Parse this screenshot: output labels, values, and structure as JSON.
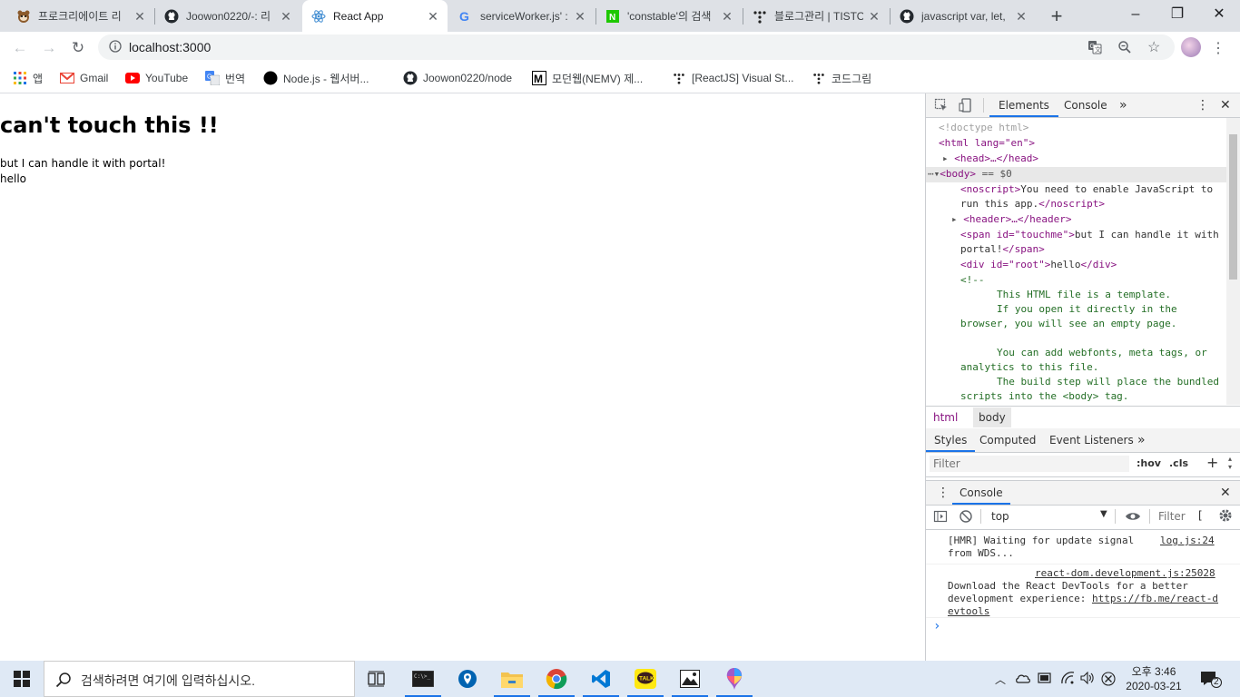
{
  "tabs": [
    {
      "title": "프로크리에이트 리",
      "icon": "tanuki-icon",
      "active": false
    },
    {
      "title": "Joowon0220/-: 리",
      "icon": "github-icon",
      "active": false
    },
    {
      "title": "React App",
      "icon": "react-icon",
      "active": true
    },
    {
      "title": "serviceWorker.js' :",
      "icon": "google-icon",
      "active": false
    },
    {
      "title": "'constable'의 검색",
      "icon": "naver-icon",
      "active": false
    },
    {
      "title": "블로그관리 | TISTO",
      "icon": "tistory-icon",
      "active": false
    },
    {
      "title": "javascript var, let,",
      "icon": "github-icon",
      "active": false
    }
  ],
  "new_tab_label": "+",
  "window_controls": {
    "minimize": "–",
    "restore": "❐",
    "close": "✕"
  },
  "address_bar": {
    "url": "localhost:3000"
  },
  "bookmarks": [
    {
      "label": "앱",
      "icon": "apps-grid-icon"
    },
    {
      "label": "Gmail",
      "icon": "gmail-icon"
    },
    {
      "label": "YouTube",
      "icon": "youtube-icon"
    },
    {
      "label": "번역",
      "icon": "translate-icon"
    },
    {
      "label": "Node.js - 웹서버...",
      "icon": "circle-icon"
    },
    {
      "label": "Joowon0220/node",
      "icon": "github-icon"
    },
    {
      "label": "모던웹(NEMV) 제...",
      "icon": "m-icon"
    },
    {
      "label": "[ReactJS] Visual St...",
      "icon": "tistory-icon"
    },
    {
      "label": "코드그림",
      "icon": "tistory-icon"
    }
  ],
  "page": {
    "heading": "can't touch this !!",
    "portal_text": "but I can handle it with portal!",
    "root_text": "hello"
  },
  "devtools": {
    "tabs": [
      "Elements",
      "Console"
    ],
    "elements_lines": {
      "doctype": "<!doctype html>",
      "html_open": "<html lang=\"en\">",
      "head": "<head>…</head>",
      "body": "<body>",
      "body_suffix": " == $0",
      "noscript_open": "<noscript>",
      "noscript_text": "You need to enable JavaScript to",
      "noscript_text2": "run this app.",
      "noscript_close": "</noscript>",
      "header": "<header>…</header>",
      "span_open": "<span id=\"touchme\">",
      "span_text": "but I can handle it with",
      "span_text2": "portal!",
      "span_close": "</span>",
      "div_open": "<div id=\"root\">",
      "div_text": "hello",
      "div_close": "</div>",
      "comment_open": "<!--",
      "c1": "This HTML file is a template.",
      "c2": "If you open it directly in the",
      "c3": "browser, you will see an empty page.",
      "c4": "You can add webfonts, meta tags, or",
      "c5": "analytics to this file.",
      "c6": "The build step will place the bundled",
      "c7": "scripts into the <body> tag."
    },
    "breadcrumbs": [
      "html",
      "body"
    ],
    "styles_tabs": [
      "Styles",
      "Computed",
      "Event Listeners"
    ],
    "styles_filter_placeholder": "Filter",
    "styles_hov": ":hov",
    "styles_cls": ".cls",
    "drawer_title": "Console",
    "console_context": "top",
    "console_filter_placeholder": "Filter",
    "console_messages": [
      {
        "text1": "[HMR] Waiting for update signal",
        "text2": "from WDS...",
        "source": "log.js:24"
      },
      {
        "source": "react-dom.development.js:25028",
        "text1": "Download the React DevTools for a better",
        "text2": "development experience: ",
        "link1": "https://fb.me/react-d",
        "link2": "evtools"
      }
    ],
    "prompt": "›"
  },
  "taskbar": {
    "search_placeholder": "검색하려면 여기에 입력하십시오.",
    "time": "오후 3:46",
    "date": "2020-03-21",
    "notifications": "2"
  }
}
